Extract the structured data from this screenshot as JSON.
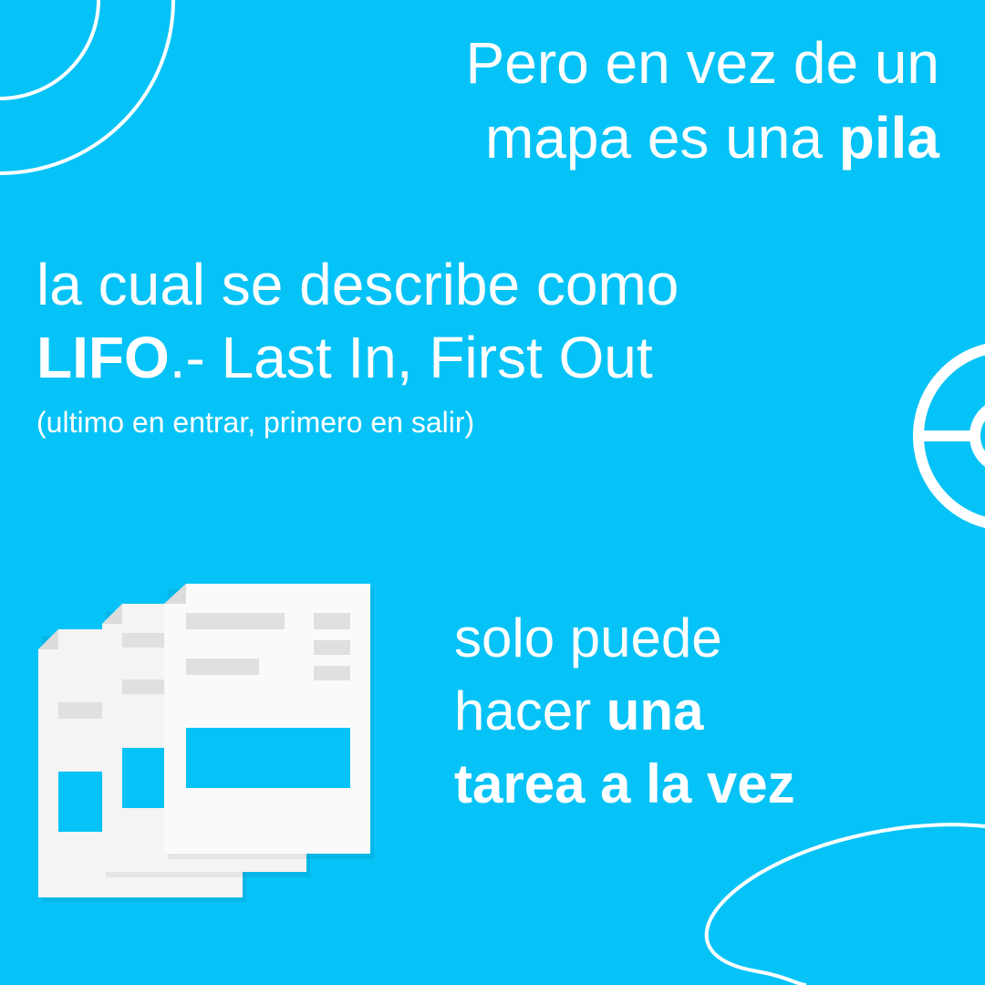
{
  "colors": {
    "background": "#06c3f7",
    "foreground": "#ffffff",
    "doc_page": "#f4f4f4",
    "doc_lines": "#e0e0e0"
  },
  "heading": {
    "line1": "Pero en vez de un",
    "line2_prefix": "mapa es una ",
    "line2_bold": "pila"
  },
  "lifo": {
    "line1": "la cual se describe como",
    "bold": "LIFO",
    "rest": ".- Last In, First Out",
    "subtitle": "(ultimo en entrar, primero en salir)"
  },
  "task": {
    "line1": "solo puede",
    "line2_prefix": "hacer ",
    "line2_bold": "una",
    "line3_bold": "tarea a la vez"
  },
  "illustration": {
    "icon": "document-stack-icon"
  }
}
